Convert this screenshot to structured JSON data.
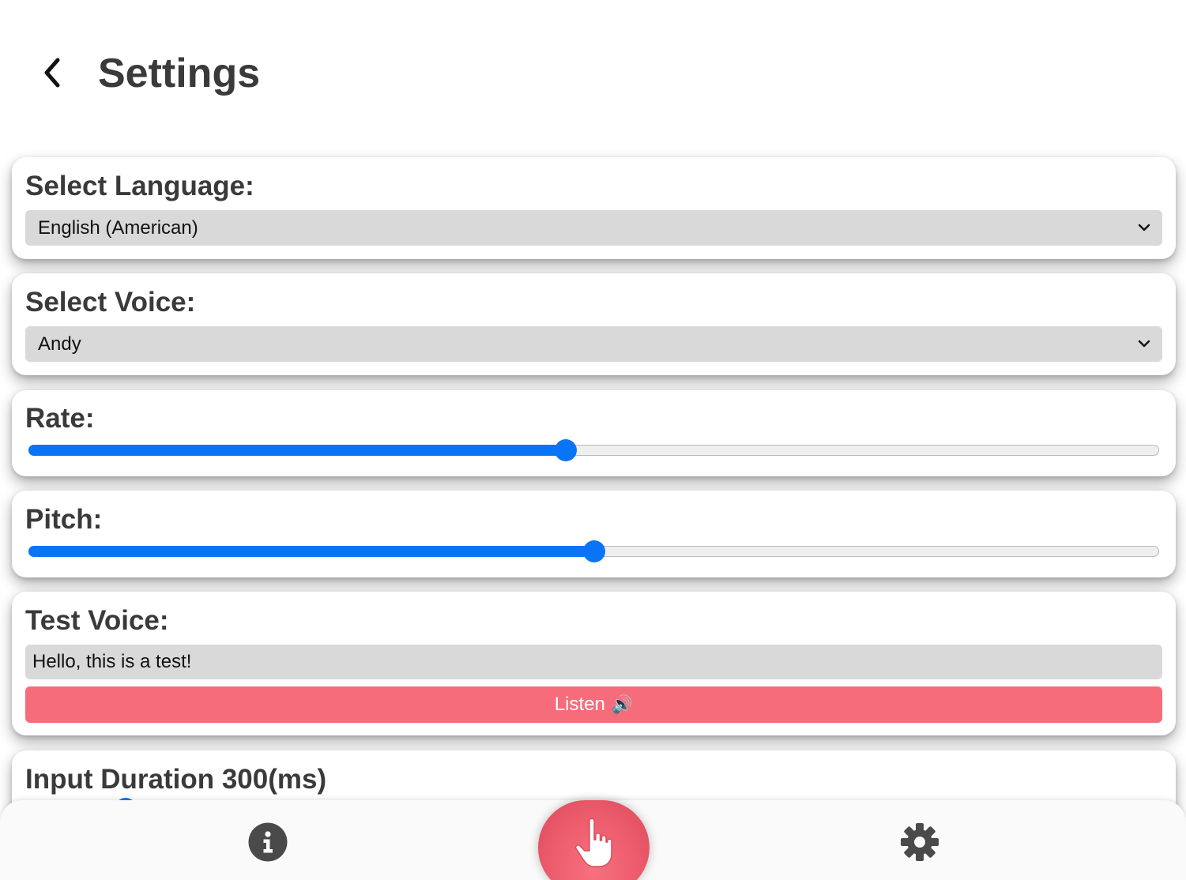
{
  "header": {
    "title": "Settings"
  },
  "language": {
    "label": "Select Language:",
    "selected": "English (American)"
  },
  "voice": {
    "label": "Select Voice:",
    "selected": "Andy"
  },
  "rate": {
    "label": "Rate:",
    "value_fraction": 0.475
  },
  "pitch": {
    "label": "Pitch:",
    "value_fraction": 0.5
  },
  "test_voice": {
    "label": "Test Voice:",
    "input_value": "Hello, this is a test!",
    "button_label": "Listen",
    "button_icon": "🔊"
  },
  "input_duration": {
    "label": "Input Duration 300(ms)"
  },
  "nav": {
    "left_icon": "info-icon",
    "center_icon": "pointing-hand-icon",
    "right_icon": "gear-icon"
  },
  "colors": {
    "accent": "#f76c7b",
    "slider": "#0a74f6",
    "title": "#3a3a3a"
  }
}
